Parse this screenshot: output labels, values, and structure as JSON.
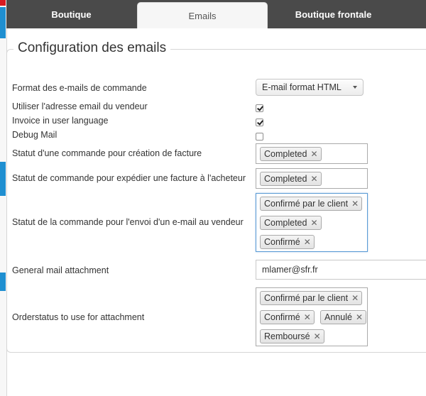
{
  "tabs": [
    {
      "label": "Boutique"
    },
    {
      "label": "Emails"
    },
    {
      "label": "Boutique frontale"
    }
  ],
  "section": {
    "title": "Configuration des emails"
  },
  "fields": {
    "format": {
      "label": "Format des e-mails de commande",
      "value": "E-mail format HTML"
    },
    "vendor_email": {
      "label": "Utiliser l'adresse email du vendeur",
      "checked": true
    },
    "invoice_lang": {
      "label": "Invoice in user language",
      "checked": true
    },
    "debug_mail": {
      "label": "Debug Mail",
      "checked": false
    },
    "invoice_status": {
      "label": "Statut d'une commande pour création de facture",
      "tags": [
        "Completed"
      ]
    },
    "ship_invoice_status": {
      "label": "Statut de commande pour expédier une facture à l'acheteur",
      "tags": [
        "Completed"
      ]
    },
    "vendor_mail_status": {
      "label": "Statut de la commande pour l'envoi d'un e-mail au vendeur",
      "tags": [
        "Confirmé par le client",
        "Completed",
        "Confirmé"
      ]
    },
    "attachment": {
      "label": "General mail attachment",
      "value": "mlamer@sfr.fr"
    },
    "attachment_status": {
      "label": "Orderstatus to use for attachment",
      "tags": [
        "Confirmé par le client",
        "Confirmé",
        "Annulé",
        "Remboursé"
      ]
    }
  },
  "colors": {
    "accent_blue": "#1f8fd1",
    "accent_red": "#d71920",
    "tabbar": "#4a4a4a"
  }
}
